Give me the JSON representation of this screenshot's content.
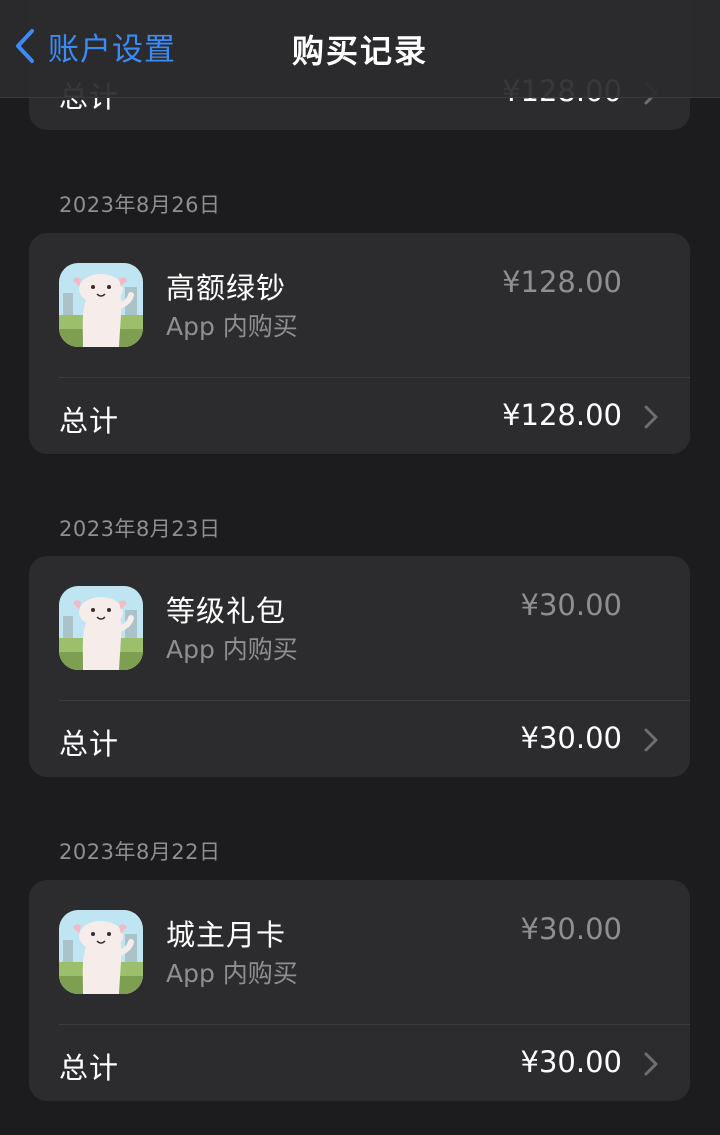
{
  "navbar": {
    "back_label": "账户设置",
    "title": "购买记录"
  },
  "top_partial": {
    "total_label": "总计",
    "total_price": "¥128.00"
  },
  "groups": [
    {
      "date": "2023年8月26日",
      "item_name": "高额绿钞",
      "item_type": "App 内购买",
      "item_price": "¥128.00",
      "total_label": "总计",
      "total_price": "¥128.00"
    },
    {
      "date": "2023年8月23日",
      "item_name": "等级礼包",
      "item_type": "App 内购买",
      "item_price": "¥30.00",
      "total_label": "总计",
      "total_price": "¥30.00"
    },
    {
      "date": "2023年8月22日",
      "item_name": "城主月卡",
      "item_type": "App 内购买",
      "item_price": "¥30.00",
      "total_label": "总计",
      "total_price": "¥30.00"
    }
  ],
  "icons": {
    "back": "chevron-left-icon",
    "disclosure": "chevron-right-icon",
    "app": "axolotl-app-icon"
  },
  "colors": {
    "background": "#1c1c1e",
    "card": "#2c2c2e",
    "accent": "#3b8bf7",
    "secondary_text": "#8e8e93"
  }
}
